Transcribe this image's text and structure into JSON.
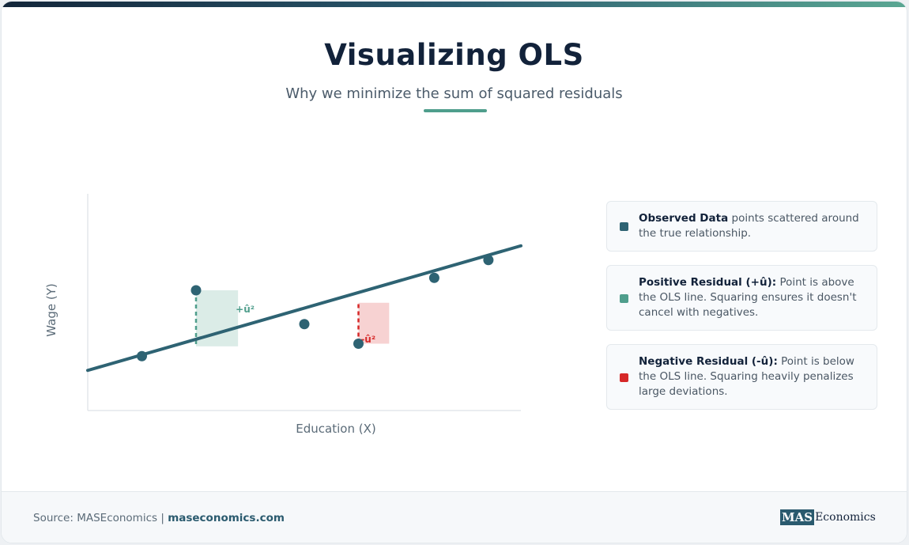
{
  "header": {
    "title": "Visualizing OLS",
    "subtitle": "Why we minimize the sum of squared residuals"
  },
  "colors": {
    "accent": "#4f9e8c",
    "line": "#2e6373",
    "point": "#2e6373",
    "positive_fill": "#d9ebe6",
    "positive_stroke": "#4f9e8c",
    "negative_fill": "#f7d0d0",
    "negative_stroke": "#d62828"
  },
  "chart_data": {
    "type": "scatter",
    "xlabel": "Education (X)",
    "ylabel": "Wage (Y)",
    "xlim": [
      0,
      100
    ],
    "ylim": [
      0,
      100
    ],
    "grid": false,
    "points": [
      {
        "x": 12.5,
        "y": 23
      },
      {
        "x": 25,
        "y": 60
      },
      {
        "x": 50,
        "y": 41
      },
      {
        "x": 62.5,
        "y": 30
      },
      {
        "x": 80,
        "y": 67
      },
      {
        "x": 92.5,
        "y": 77
      }
    ],
    "fit_line": {
      "x": [
        0,
        100
      ],
      "y": [
        15,
        85
      ]
    },
    "residuals": [
      {
        "label": "+û²",
        "kind": "positive",
        "x": 25,
        "y_obs": 60,
        "y_fit": 28.5
      },
      {
        "label": "-û²",
        "kind": "negative",
        "x": 62.5,
        "y_obs": 30,
        "y_fit": 53
      }
    ]
  },
  "legend": [
    {
      "term": "Observed Data",
      "text": " points scattered around the true relationship.",
      "color": "#2e6373"
    },
    {
      "term": "Positive Residual (+û):",
      "text": " Point is above the OLS line. Squaring ensures it doesn't cancel with negatives.",
      "color": "#4f9e8c"
    },
    {
      "term": "Negative Residual (-û):",
      "text": " Point is below the OLS line. Squaring heavily penalizes large deviations.",
      "color": "#d62828"
    }
  ],
  "footer": {
    "source_prefix": "Source: MASEconomics | ",
    "source_site": "maseconomics.com",
    "logo_mas": "MAS",
    "logo_rest": "Economics"
  }
}
